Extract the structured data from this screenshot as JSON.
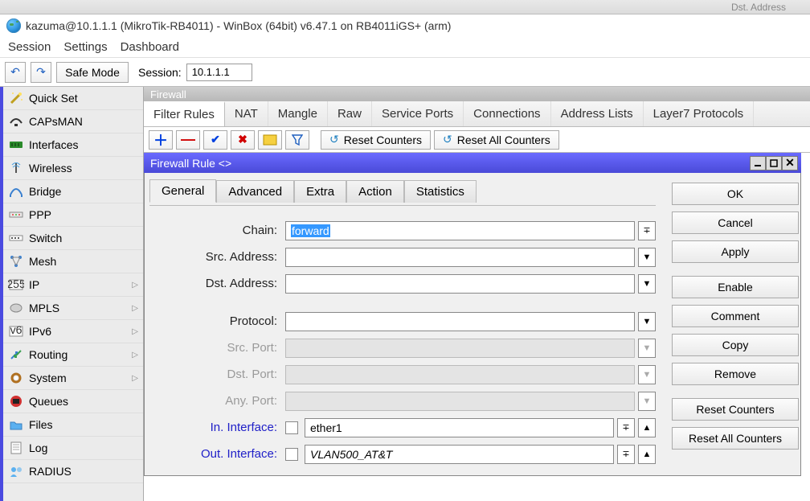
{
  "ghost_text": "Dst. Address",
  "window_title": "kazuma@10.1.1.1 (MikroTik-RB4011) - WinBox (64bit) v6.47.1 on RB4011iGS+ (arm)",
  "menubar": [
    "Session",
    "Settings",
    "Dashboard"
  ],
  "toolbar": {
    "safe_mode": "Safe Mode",
    "session_label": "Session:",
    "session_value": "10.1.1.1"
  },
  "sidebar": [
    {
      "label": "Quick Set",
      "arrow": false,
      "icon": "wand"
    },
    {
      "label": "CAPsMAN",
      "arrow": false,
      "icon": "wifi-dark"
    },
    {
      "label": "Interfaces",
      "arrow": false,
      "icon": "iface"
    },
    {
      "label": "Wireless",
      "arrow": false,
      "icon": "antenna"
    },
    {
      "label": "Bridge",
      "arrow": false,
      "icon": "bridge"
    },
    {
      "label": "PPP",
      "arrow": false,
      "icon": "ppp"
    },
    {
      "label": "Switch",
      "arrow": false,
      "icon": "switch"
    },
    {
      "label": "Mesh",
      "arrow": false,
      "icon": "mesh"
    },
    {
      "label": "IP",
      "arrow": true,
      "icon": "ip"
    },
    {
      "label": "MPLS",
      "arrow": true,
      "icon": "mpls"
    },
    {
      "label": "IPv6",
      "arrow": true,
      "icon": "ipv6"
    },
    {
      "label": "Routing",
      "arrow": true,
      "icon": "routing"
    },
    {
      "label": "System",
      "arrow": true,
      "icon": "gear"
    },
    {
      "label": "Queues",
      "arrow": false,
      "icon": "queues"
    },
    {
      "label": "Files",
      "arrow": false,
      "icon": "folder"
    },
    {
      "label": "Log",
      "arrow": false,
      "icon": "log"
    },
    {
      "label": "RADIUS",
      "arrow": false,
      "icon": "radius"
    }
  ],
  "firewall": {
    "panel_title": "Firewall",
    "tabs": [
      "Filter Rules",
      "NAT",
      "Mangle",
      "Raw",
      "Service Ports",
      "Connections",
      "Address Lists",
      "Layer7 Protocols"
    ],
    "active_tab": 0,
    "toolbar": {
      "reset_counters": "Reset Counters",
      "reset_all": "Reset All Counters"
    }
  },
  "dialog": {
    "title": "Firewall Rule <>",
    "tabs": [
      "General",
      "Advanced",
      "Extra",
      "Action",
      "Statistics"
    ],
    "active_tab": 0,
    "buttons": [
      "OK",
      "Cancel",
      "Apply",
      "Enable",
      "Comment",
      "Copy",
      "Remove",
      "Reset Counters",
      "Reset All Counters"
    ],
    "fields": {
      "chain": {
        "label": "Chain:",
        "value": "forward",
        "disabled": false,
        "selected": true
      },
      "src_addr": {
        "label": "Src. Address:",
        "value": "",
        "disabled": false
      },
      "dst_addr": {
        "label": "Dst. Address:",
        "value": "",
        "disabled": false
      },
      "protocol": {
        "label": "Protocol:",
        "value": "",
        "disabled": false
      },
      "src_port": {
        "label": "Src. Port:",
        "value": "",
        "disabled": true
      },
      "dst_port": {
        "label": "Dst. Port:",
        "value": "",
        "disabled": true
      },
      "any_port": {
        "label": "Any. Port:",
        "value": "",
        "disabled": true
      },
      "in_iface": {
        "label": "In. Interface:",
        "value": "ether1",
        "disabled": false,
        "link": true,
        "checkbox": true
      },
      "out_iface": {
        "label": "Out. Interface:",
        "value": "VLAN500_AT&T",
        "disabled": false,
        "link": true,
        "checkbox": true,
        "italic": true
      }
    }
  }
}
